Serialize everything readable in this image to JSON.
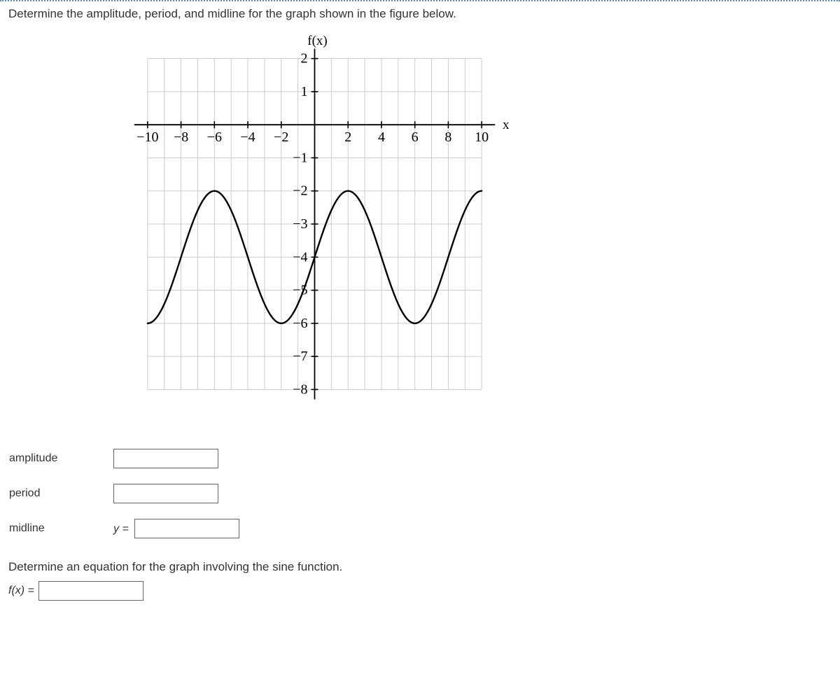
{
  "prompt1": "Determine the amplitude, period, and midline for the graph shown in the figure below.",
  "prompt2": "Determine an equation for the graph involving the sine function.",
  "labels": {
    "amplitude": "amplitude",
    "period": "period",
    "midline": "midline",
    "midline_prefix": "y =",
    "fx_prefix": "f(x) ="
  },
  "chart_data": {
    "type": "line",
    "xlabel": "x",
    "ylabel": "f(x)",
    "xlim": [
      -11,
      11
    ],
    "xticks": [
      -10,
      -8,
      -6,
      -4,
      -2,
      2,
      4,
      6,
      8,
      10
    ],
    "ylim": [
      -8.2,
      2.5
    ],
    "yticks": [
      2,
      1,
      -1,
      -2,
      -3,
      -4,
      -5,
      -6,
      -7,
      -8
    ],
    "sine": {
      "amplitude": 2,
      "period": 8,
      "midline": -4
    }
  }
}
